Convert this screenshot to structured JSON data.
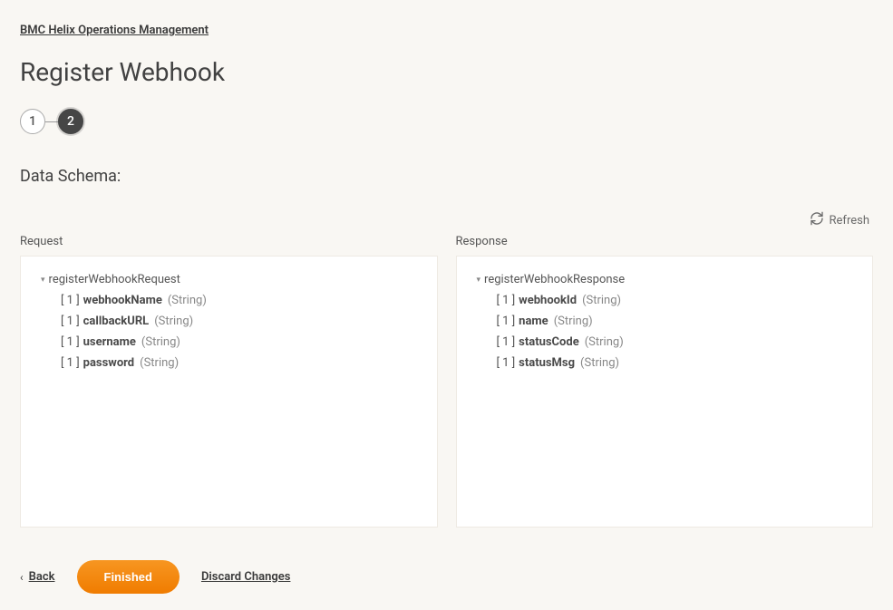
{
  "breadcrumb": "BMC Helix Operations Management",
  "page_title": "Register Webhook",
  "stepper": {
    "step1": "1",
    "step2": "2"
  },
  "section_title": "Data Schema:",
  "refresh_label": "Refresh",
  "request": {
    "title": "Request",
    "root": "registerWebhookRequest",
    "fields": [
      {
        "card": "[ 1 ]",
        "name": "webhookName",
        "type": "(String)"
      },
      {
        "card": "[ 1 ]",
        "name": "callbackURL",
        "type": "(String)"
      },
      {
        "card": "[ 1 ]",
        "name": "username",
        "type": "(String)"
      },
      {
        "card": "[ 1 ]",
        "name": "password",
        "type": "(String)"
      }
    ]
  },
  "response": {
    "title": "Response",
    "root": "registerWebhookResponse",
    "fields": [
      {
        "card": "[ 1 ]",
        "name": "webhookId",
        "type": "(String)"
      },
      {
        "card": "[ 1 ]",
        "name": "name",
        "type": "(String)"
      },
      {
        "card": "[ 1 ]",
        "name": "statusCode",
        "type": "(String)"
      },
      {
        "card": "[ 1 ]",
        "name": "statusMsg",
        "type": "(String)"
      }
    ]
  },
  "footer": {
    "back": "Back",
    "finished": "Finished",
    "discard": "Discard Changes"
  }
}
